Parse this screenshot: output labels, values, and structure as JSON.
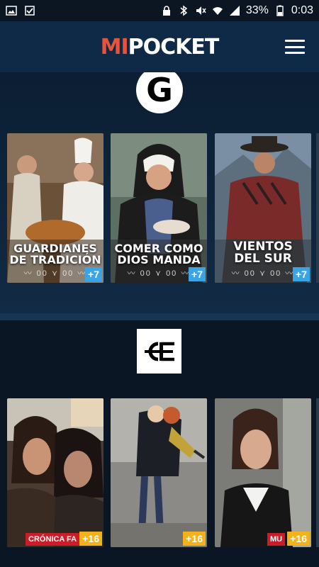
{
  "status_bar": {
    "battery": "33%",
    "time": "0:03"
  },
  "header": {
    "logo_part1": "MI",
    "logo_part2": "POCKET"
  },
  "channel1": {
    "logo_letter": "G",
    "cards": [
      {
        "title_line1": "GUARDIANES",
        "title_line2": "DE TRADICIÓN",
        "deco": "〰 00 ⋎ 00 〰",
        "badge": "+7"
      },
      {
        "title_line1": "COMER COMO",
        "title_line2": "DIOS MANDA",
        "deco": "〰 00 ⋎ 00 〰",
        "badge": "+7"
      },
      {
        "title_line1": "VIENTOS",
        "title_line2": "DEL SUR",
        "deco": "〰 00 ⋎ 00 〰",
        "badge": "+7"
      }
    ]
  },
  "channel2": {
    "cards": [
      {
        "tag": "CRÓNICA FA",
        "badge": "+16"
      },
      {
        "tag": "",
        "badge": "+16"
      },
      {
        "tag": "MU",
        "badge": "+16"
      }
    ]
  },
  "colors": {
    "accent": "#e8533a",
    "badge_blue": "#3aa5e6",
    "badge_yellow": "#f2b21c",
    "tag_red": "#c91d2a"
  }
}
